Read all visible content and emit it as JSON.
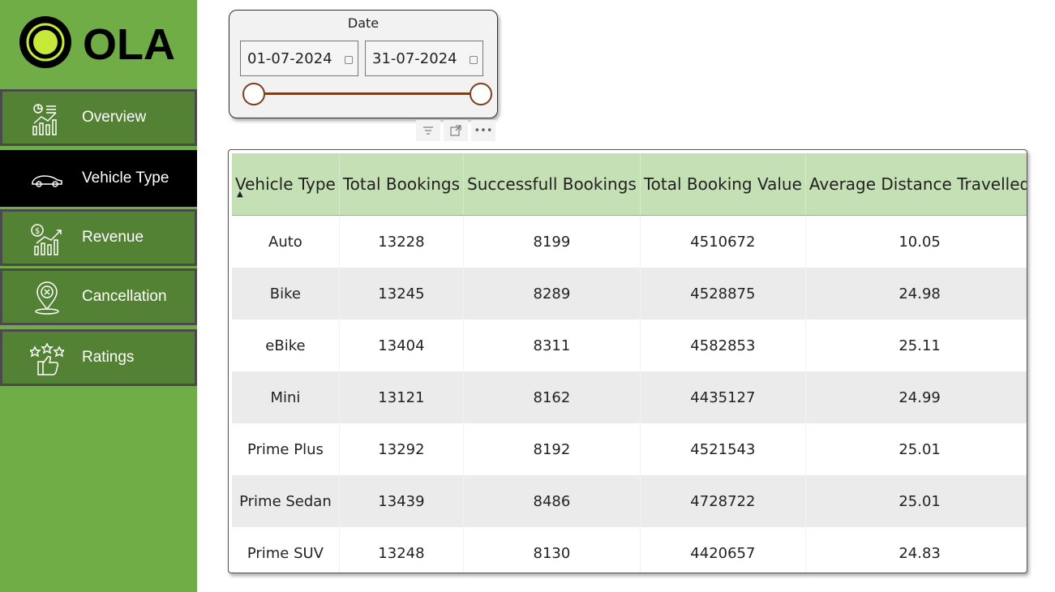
{
  "brand": {
    "logo_text": "OLA",
    "accent": "#70ad47",
    "logo_ring": "#c7e93a"
  },
  "nav": [
    {
      "label": "Overview",
      "icon": "analytics-icon"
    },
    {
      "label": "Vehicle Type",
      "icon": "car-icon",
      "active": true
    },
    {
      "label": "Revenue",
      "icon": "revenue-chart-icon"
    },
    {
      "label": "Cancellation",
      "icon": "location-cancel-icon"
    },
    {
      "label": "Ratings",
      "icon": "thumbs-up-stars-icon"
    }
  ],
  "date_slicer": {
    "title": "Date",
    "start": "01-07-2024",
    "end": "31-07-2024"
  },
  "visual_tools": [
    "filter-icon",
    "focus-mode-icon",
    "more-options-icon"
  ],
  "table": {
    "columns": [
      "Vehicle Type",
      "Total Bookings",
      "Successfull Bookings",
      "Total Booking Value",
      "Average Distance Travelled"
    ],
    "rows": [
      [
        "Auto",
        "13228",
        "8199",
        "4510672",
        "10.05"
      ],
      [
        "Bike",
        "13245",
        "8289",
        "4528875",
        "24.98"
      ],
      [
        "eBike",
        "13404",
        "8311",
        "4582853",
        "25.11"
      ],
      [
        "Mini",
        "13121",
        "8162",
        "4435127",
        "24.99"
      ],
      [
        "Prime Plus",
        "13292",
        "8192",
        "4521543",
        "25.01"
      ],
      [
        "Prime Sedan",
        "13439",
        "8486",
        "4728722",
        "25.01"
      ],
      [
        "Prime SUV",
        "13248",
        "8130",
        "4420657",
        "24.83"
      ]
    ]
  }
}
